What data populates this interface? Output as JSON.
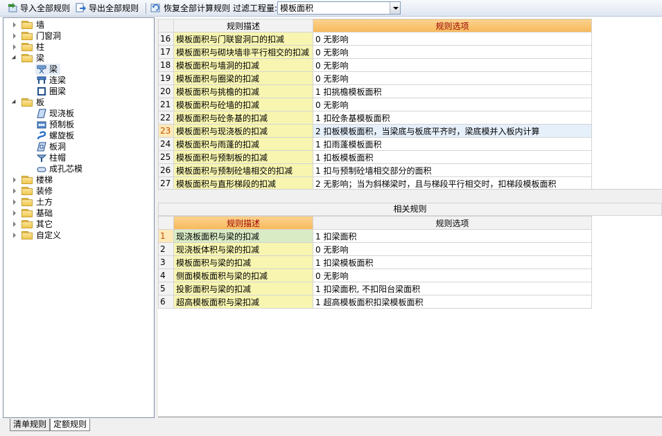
{
  "toolbar": {
    "import_label": "导入全部规则",
    "export_label": "导出全部规则",
    "restore_label": "恢复全部计算规则",
    "filter_label": "过滤工程量:",
    "filter_value": "模板面积"
  },
  "tree": {
    "wall": "墙",
    "door_window_opening": "门窗洞",
    "column": "柱",
    "beam": "梁",
    "beam_children": [
      "梁",
      "连梁",
      "圈梁"
    ],
    "slab": "板",
    "slab_children": [
      "现浇板",
      "预制板",
      "螺旋板",
      "板洞",
      "柱帽",
      "成孔芯模"
    ],
    "stairs": "楼梯",
    "decoration": "装修",
    "earthwork": "土方",
    "foundation": "基础",
    "other": "其它",
    "custom": "自定义"
  },
  "tabs": {
    "list_rules": "清单规则",
    "quota_rules": "定额规则"
  },
  "top_grid": {
    "col_desc": "规则描述",
    "col_option": "规则选项",
    "rows": [
      {
        "no": "16",
        "desc": "模板面积与门联窗洞口的扣减",
        "option": "0   无影响"
      },
      {
        "no": "17",
        "desc": "模板面积与砌块墙非平行相交的扣减",
        "option": "0   无影响"
      },
      {
        "no": "18",
        "desc": "模板面积与墙洞的扣减",
        "option": "0   无影响"
      },
      {
        "no": "19",
        "desc": "模板面积与圈梁的扣减",
        "option": "0   无影响"
      },
      {
        "no": "20",
        "desc": "模板面积与挑檐的扣减",
        "option": "1  扣挑檐模板面积"
      },
      {
        "no": "21",
        "desc": "模板面积与砼墙的扣减",
        "option": "0   无影响"
      },
      {
        "no": "22",
        "desc": "模板面积与砼条基的扣减",
        "option": "1  扣砼条基模板面积"
      },
      {
        "no": "23",
        "desc": "模板面积与现浇板的扣减",
        "option": "2  扣板模板面积，当梁底与板底平齐时，梁底模并入板内计算"
      },
      {
        "no": "24",
        "desc": "模板面积与雨蓬的扣减",
        "option": "1  扣雨蓬模板面积"
      },
      {
        "no": "25",
        "desc": "模板面积与预制板的扣减",
        "option": "1  扣板模板面积"
      },
      {
        "no": "26",
        "desc": "模板面积与预制砼墙相交的扣减",
        "option": "1  扣与预制砼墙相交部分的面积"
      },
      {
        "no": "27",
        "desc": "模板面积与直形梯段的扣减",
        "option": "2  无影响；当为斜梯梁时，且与梯段平行相交时，扣梯段模板面积"
      }
    ]
  },
  "related": {
    "title": "相关规则",
    "col_desc": "规则描述",
    "col_option": "规则选项",
    "rows": [
      {
        "no": "1",
        "desc": "现浇板面积与梁的扣减",
        "option": "1   扣梁面积"
      },
      {
        "no": "2",
        "desc": "现浇板体积与梁的扣减",
        "option": "0   无影响"
      },
      {
        "no": "3",
        "desc": "模板面积与梁的扣减",
        "option": "1   扣梁模板面积"
      },
      {
        "no": "4",
        "desc": "侧面模板面积与梁的扣减",
        "option": "0   无影响"
      },
      {
        "no": "5",
        "desc": "投影面积与梁的扣减",
        "option": "1   扣梁面积, 不扣阳台梁面积"
      },
      {
        "no": "6",
        "desc": "超高模板面积与梁扣减",
        "option": "1   超高模板面积扣梁模板面积"
      }
    ]
  }
}
